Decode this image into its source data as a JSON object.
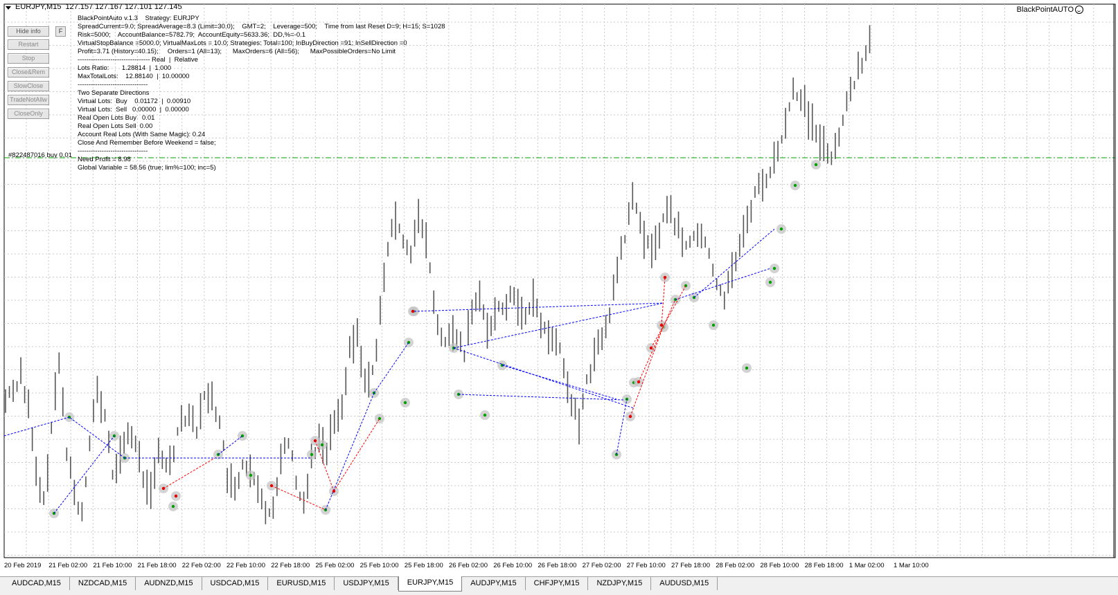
{
  "chart_header": {
    "symbol": "EURJPY,M15",
    "ohlc": "127.157 127.167 127.101 127.145"
  },
  "expert_label": "BlackPointAUTO",
  "panel_buttons": [
    {
      "label": "Hide info"
    },
    {
      "label": "Restart"
    },
    {
      "label": "Stop"
    },
    {
      "label": "Close&Rem"
    },
    {
      "label": "SlowClose"
    },
    {
      "label": "TradeNotAllw"
    },
    {
      "label": "CloseOnly"
    }
  ],
  "f_button": "F",
  "info_lines": [
    "BlackPointAuto v.1.3    Strategy: EURJPY",
    "SpreadCurrent=9.0; SpreadAverage=8.3 (Limit=30.0);    GMT=2;    Leverage=500;    Time from last Reset D=9; H=15; S=1028",
    "Risk=5000;    AccountBalance=5782.79;  AccountEquity=5633.36;  DD,%=-0.1",
    "VirtualStopBalance =5000.0; VirtualMaxLots = 10.0; Strategies: Total=100; InBuyDirection =91; InSellDirection =0",
    "Profit=3.71 (History=40.15);     Orders=1 (All=13);      MaxOrders=6 (All=56);      MaxPossibleOrders=No Limit",
    "--------------------------------- Real  |  Relative",
    "Lots Ratio:       1.28814  |  1.000",
    "MaxTotalLots:    12.88140  |  10.00000",
    "--------------------------------",
    "Two Separate Directions",
    "Virtual Lots:  Buy    0.01172  |  0.00910",
    "Virtual Lots:  Sell   0.00000  |  0.00000",
    "Real Open Lots Buy   0.01",
    "Real Open Lots Sell  0.00",
    "Account Real Lots (With Same Magic): 0.24",
    "Close And Remember Before Weekend = false;",
    "--------------------------------",
    "Need Profit = 8.98",
    "Global Variable = 58.56 (true; lim%=100; inc=5)"
  ],
  "order_label": "#822487016 buy 0.01",
  "x_labels": [
    "20 Feb 2019",
    "21 Feb 02:00",
    "21 Feb 10:00",
    "21 Feb 18:00",
    "22 Feb 02:00",
    "22 Feb 10:00",
    "22 Feb 18:00",
    "25 Feb 02:00",
    "25 Feb 10:00",
    "25 Feb 18:00",
    "26 Feb 02:00",
    "26 Feb 10:00",
    "26 Feb 18:00",
    "27 Feb 02:00",
    "27 Feb 10:00",
    "27 Feb 18:00",
    "28 Feb 02:00",
    "28 Feb 10:00",
    "28 Feb 18:00",
    "1 Mar 02:00",
    "1 Mar 10:00"
  ],
  "tabs": [
    {
      "label": "AUDCAD,M15",
      "active": false
    },
    {
      "label": "NZDCAD,M15",
      "active": false
    },
    {
      "label": "AUDNZD,M15",
      "active": false
    },
    {
      "label": "USDCAD,M15",
      "active": false
    },
    {
      "label": "EURUSD,M15",
      "active": false
    },
    {
      "label": "USDJPY,M15",
      "active": false
    },
    {
      "label": "EURJPY,M15",
      "active": true
    },
    {
      "label": "AUDJPY,M15",
      "active": false
    },
    {
      "label": "CHFJPY,M15",
      "active": false
    },
    {
      "label": "NZDJPY,M15",
      "active": false
    },
    {
      "label": "AUDUSD,M15",
      "active": false
    }
  ],
  "colors": {
    "bars": "#555555",
    "grid": "#c8c8c8",
    "buy_line": "#0000ff",
    "sell_line": "#ff0000",
    "order_line": "#00a000",
    "marker_circle": "#c0c0c0"
  },
  "chart_data": {
    "type": "bar",
    "symbol": "EURJPY",
    "timeframe": "M15",
    "price_path": [
      [
        0,
        0.28
      ],
      [
        2,
        0.3
      ],
      [
        4,
        0.34
      ],
      [
        6,
        0.26
      ],
      [
        8,
        0.12
      ],
      [
        10,
        0.06
      ],
      [
        12,
        0.22
      ],
      [
        14,
        0.36
      ],
      [
        16,
        0.18
      ],
      [
        18,
        0.08
      ],
      [
        20,
        0.04
      ],
      [
        22,
        0.2
      ],
      [
        24,
        0.3
      ],
      [
        26,
        0.24
      ],
      [
        28,
        0.12
      ],
      [
        30,
        0.16
      ],
      [
        32,
        0.22
      ],
      [
        34,
        0.18
      ],
      [
        36,
        0.12
      ],
      [
        38,
        0.1
      ],
      [
        40,
        0.16
      ],
      [
        42,
        0.14
      ],
      [
        44,
        0.18
      ],
      [
        46,
        0.24
      ],
      [
        48,
        0.26
      ],
      [
        50,
        0.22
      ],
      [
        52,
        0.28
      ],
      [
        54,
        0.3
      ],
      [
        56,
        0.22
      ],
      [
        58,
        0.12
      ],
      [
        60,
        0.08
      ],
      [
        62,
        0.14
      ],
      [
        64,
        0.12
      ],
      [
        66,
        0.08
      ],
      [
        68,
        0.04
      ],
      [
        70,
        0.06
      ],
      [
        72,
        0.16
      ],
      [
        74,
        0.2
      ],
      [
        76,
        0.1
      ],
      [
        78,
        0.06
      ],
      [
        80,
        0.16
      ],
      [
        82,
        0.2
      ],
      [
        84,
        0.18
      ],
      [
        86,
        0.24
      ],
      [
        88,
        0.28
      ],
      [
        90,
        0.38
      ],
      [
        92,
        0.42
      ],
      [
        94,
        0.32
      ],
      [
        96,
        0.34
      ],
      [
        98,
        0.46
      ],
      [
        100,
        0.6
      ],
      [
        102,
        0.66
      ],
      [
        104,
        0.62
      ],
      [
        106,
        0.6
      ],
      [
        108,
        0.66
      ],
      [
        110,
        0.62
      ],
      [
        112,
        0.48
      ],
      [
        114,
        0.4
      ],
      [
        116,
        0.42
      ],
      [
        118,
        0.4
      ],
      [
        120,
        0.38
      ],
      [
        122,
        0.46
      ],
      [
        124,
        0.5
      ],
      [
        126,
        0.44
      ],
      [
        128,
        0.46
      ],
      [
        130,
        0.48
      ],
      [
        132,
        0.5
      ],
      [
        134,
        0.48
      ],
      [
        136,
        0.46
      ],
      [
        138,
        0.5
      ],
      [
        140,
        0.44
      ],
      [
        142,
        0.42
      ],
      [
        144,
        0.4
      ],
      [
        146,
        0.36
      ],
      [
        148,
        0.28
      ],
      [
        150,
        0.22
      ],
      [
        152,
        0.32
      ],
      [
        154,
        0.38
      ],
      [
        156,
        0.4
      ],
      [
        158,
        0.46
      ],
      [
        160,
        0.56
      ],
      [
        162,
        0.62
      ],
      [
        164,
        0.7
      ],
      [
        166,
        0.66
      ],
      [
        168,
        0.6
      ],
      [
        170,
        0.62
      ],
      [
        172,
        0.66
      ],
      [
        174,
        0.68
      ],
      [
        176,
        0.64
      ],
      [
        178,
        0.6
      ],
      [
        180,
        0.62
      ],
      [
        182,
        0.64
      ],
      [
        184,
        0.58
      ],
      [
        186,
        0.52
      ],
      [
        188,
        0.5
      ],
      [
        190,
        0.56
      ],
      [
        192,
        0.6
      ],
      [
        194,
        0.66
      ],
      [
        196,
        0.72
      ],
      [
        198,
        0.74
      ],
      [
        200,
        0.76
      ],
      [
        202,
        0.8
      ],
      [
        204,
        0.86
      ],
      [
        206,
        0.94
      ],
      [
        208,
        0.92
      ],
      [
        210,
        0.88
      ],
      [
        212,
        0.84
      ],
      [
        214,
        0.82
      ],
      [
        216,
        0.8
      ],
      [
        218,
        0.84
      ],
      [
        220,
        0.9
      ],
      [
        222,
        0.96
      ],
      [
        224,
        1.0
      ],
      [
        226,
        1.04
      ]
    ]
  }
}
